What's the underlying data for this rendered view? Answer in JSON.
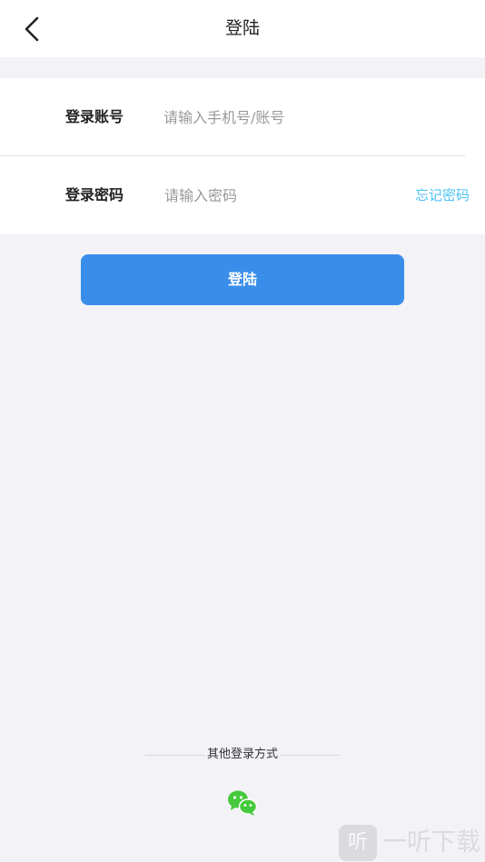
{
  "header": {
    "back_icon": "chevron-left-icon",
    "title": "登陆"
  },
  "form": {
    "account": {
      "label": "登录账号",
      "value": "",
      "placeholder": "请输入手机号/账号"
    },
    "password": {
      "label": "登录密码",
      "value": "",
      "placeholder": "请输入密码",
      "forgot_label": "忘记密码"
    }
  },
  "login_button": {
    "label": "登陆"
  },
  "other_login": {
    "label": "其他登录方式",
    "wechat_icon": "wechat-icon"
  },
  "watermark": {
    "logo_glyph": "听",
    "text": "一听下载"
  },
  "colors": {
    "background": "#f2f2f7",
    "primary_button": "#3a8ee9",
    "forgot_link": "#4fc3f7",
    "wechat_green": "#45c93c"
  }
}
